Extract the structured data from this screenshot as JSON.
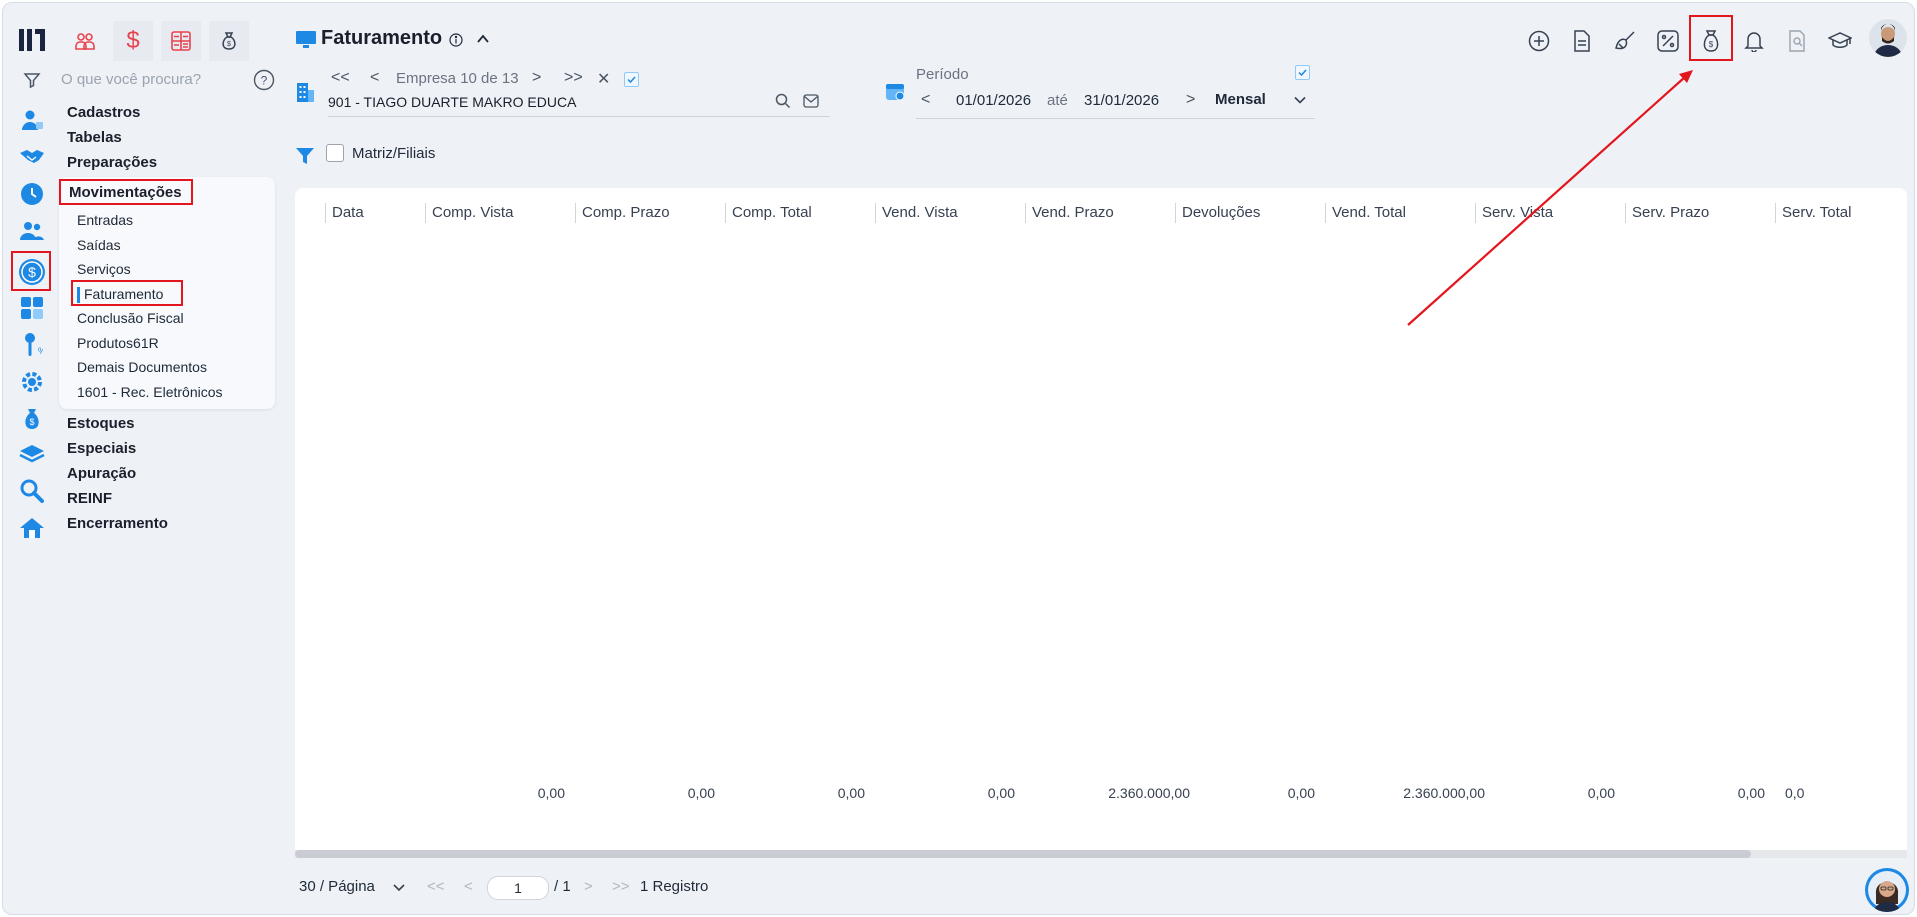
{
  "app": {
    "page_title": "Faturamento",
    "search_placeholder": "O que você procura?"
  },
  "company_nav": {
    "first": "<<",
    "prev": "<",
    "label": "Empresa 10 de 13",
    "next": ">",
    "last": ">>",
    "close": "✕",
    "company_name": "901 - TIAGO DUARTE MAKRO EDUCA"
  },
  "period": {
    "label": "Período",
    "start": "01/01/2026",
    "separator": "até",
    "end": "31/01/2026",
    "frequency": "Mensal"
  },
  "filter": {
    "matriz_label": "Matriz/Filiais"
  },
  "menu": {
    "categories": [
      "Cadastros",
      "Tabelas",
      "Preparações",
      "Movimentações",
      "Estoques",
      "Especiais",
      "Apuração",
      "REINF",
      "Encerramento"
    ],
    "submenu": [
      "Entradas",
      "Saídas",
      "Serviços",
      "Faturamento",
      "Conclusão Fiscal",
      "Produtos61R",
      "Demais Documentos",
      "1601 - Rec. Eletrônicos"
    ]
  },
  "table": {
    "columns": [
      "Data",
      "Comp. Vista",
      "Comp. Prazo",
      "Comp. Total",
      "Vend. Vista",
      "Vend. Prazo",
      "Devoluções",
      "Vend. Total",
      "Serv. Vista",
      "Serv. Prazo",
      "Serv. Total"
    ],
    "totals": [
      "0,00",
      "0,00",
      "0,00",
      "0,00",
      "2.360.000,00",
      "0,00",
      "2.360.000,00",
      "0,00",
      "0,00",
      "0,0"
    ]
  },
  "footer": {
    "page_size": "30 / Página",
    "page_value": "1",
    "page_total": "/ 1",
    "records": "1 Registro"
  },
  "colors": {
    "accent": "#1e88e5",
    "highlight": "#e3151d",
    "sidebar_active": "#1e88e5",
    "top_tab_red": "#e8424e"
  },
  "icons": {
    "top_tabs": [
      "users-icon",
      "dollar-icon",
      "calculator-icon",
      "money-bag-icon"
    ],
    "top_right": [
      "plus-circle-icon",
      "document-icon",
      "broom-icon",
      "percent-icon",
      "money-bag-icon",
      "bell-icon",
      "report-icon",
      "graduation-cap-icon"
    ]
  }
}
